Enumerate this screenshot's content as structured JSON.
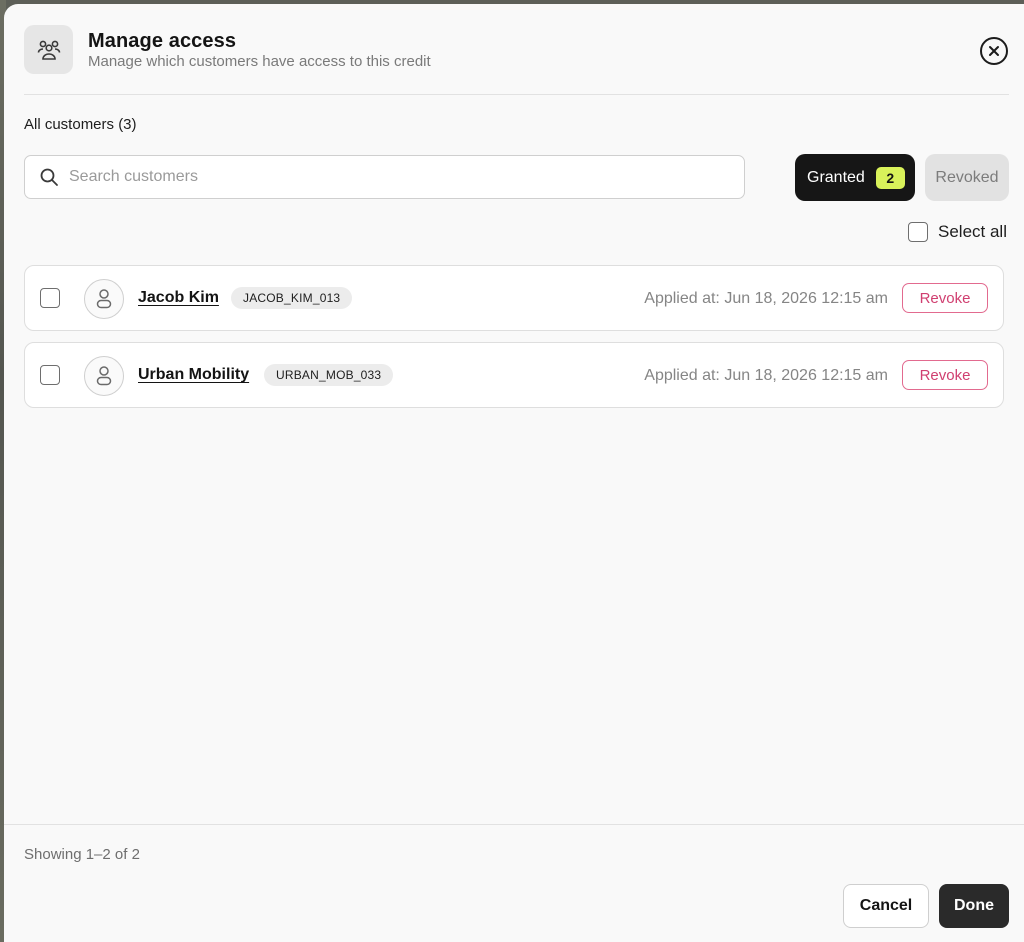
{
  "header": {
    "title": "Manage access",
    "subtitle": "Manage which customers have access to this credit",
    "icon": "users-group-icon",
    "close_icon": "close-circle-icon"
  },
  "customers_label": "All customers (3)",
  "search": {
    "placeholder": "Search customers",
    "value": ""
  },
  "filters": {
    "granted_label": "Granted",
    "granted_count": "2",
    "revoked_label": "Revoked",
    "active": "Granted"
  },
  "select_all_label": "Select all",
  "rows": [
    {
      "name": "Jacob Kim",
      "code": "JACOB_KIM_013",
      "applied": "Applied at: Jun 18, 2026 12:15 am",
      "action": "Revoke"
    },
    {
      "name": "Urban Mobility",
      "code": "URBAN_MOB_033",
      "applied": "Applied at: Jun 18, 2026 12:15 am",
      "action": "Revoke"
    }
  ],
  "footer": {
    "showing": "Showing 1–2 of 2",
    "cancel_label": "Cancel",
    "done_label": "Done"
  },
  "colors": {
    "accent_badge": "#d9f25a",
    "revoke": "#d03f70",
    "dark": "#161616"
  }
}
